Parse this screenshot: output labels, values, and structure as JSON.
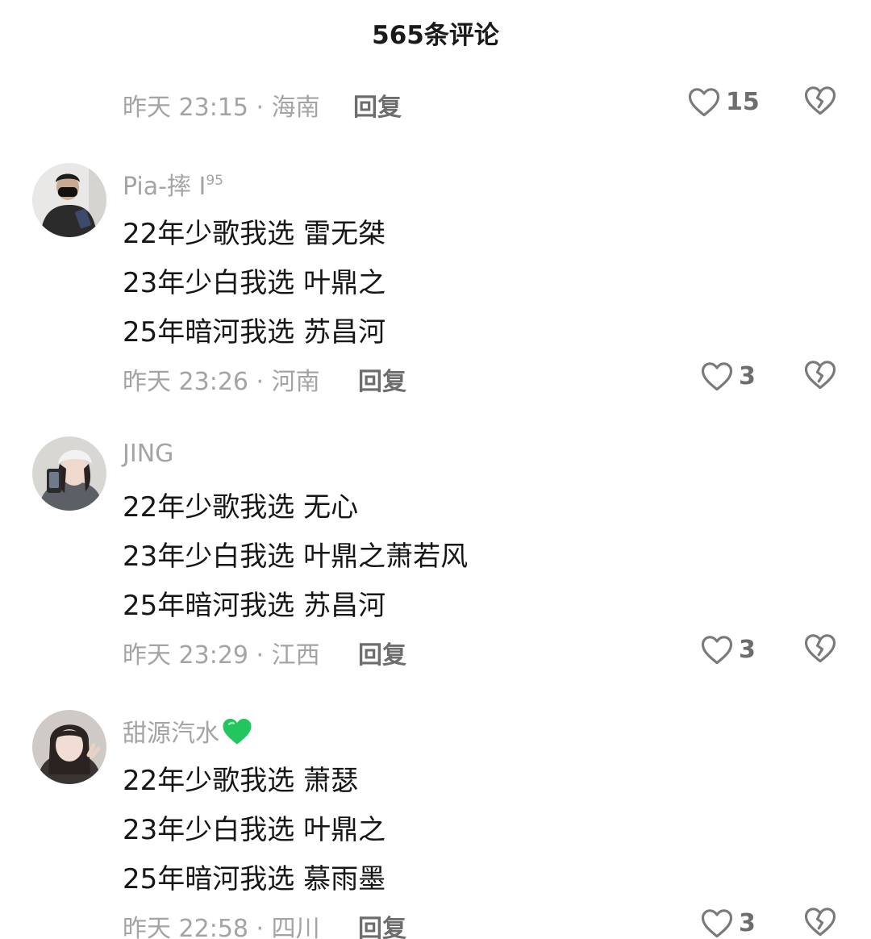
{
  "header": {
    "title": "565条评论"
  },
  "top_meta": {
    "time_location": "昨天 23:15 · 海南",
    "reply": "回复",
    "likes": "15"
  },
  "comments": [
    {
      "username": "Pia-摔 I",
      "username_sup": "95",
      "lines": [
        "22年少歌我选 雷无桀",
        "23年少白我选 叶鼎之",
        "25年暗河我选 苏昌河"
      ],
      "time_location": "昨天 23:26 · 河南",
      "reply": "回复",
      "likes": "3"
    },
    {
      "username": "JING",
      "lines": [
        "22年少歌我选  无心",
        "23年少白我选  叶鼎之萧若风",
        "25年暗河我选  苏昌河"
      ],
      "time_location": "昨天 23:29 · 江西",
      "reply": "回复",
      "likes": "3"
    },
    {
      "username": "甜源汽水",
      "username_badge": "green-heart-icon",
      "lines": [
        "22年少歌我选 萧瑟",
        "23年少白我选 叶鼎之",
        "25年暗河我选 慕雨墨"
      ],
      "time_location": "昨天 22:58 · 四川",
      "reply": "回复",
      "likes": "3"
    }
  ],
  "colors": {
    "meta_gray": "#a4a4a4",
    "action_gray": "#6d6d6d",
    "text": "#161616",
    "badge_green": "#22c55e"
  }
}
